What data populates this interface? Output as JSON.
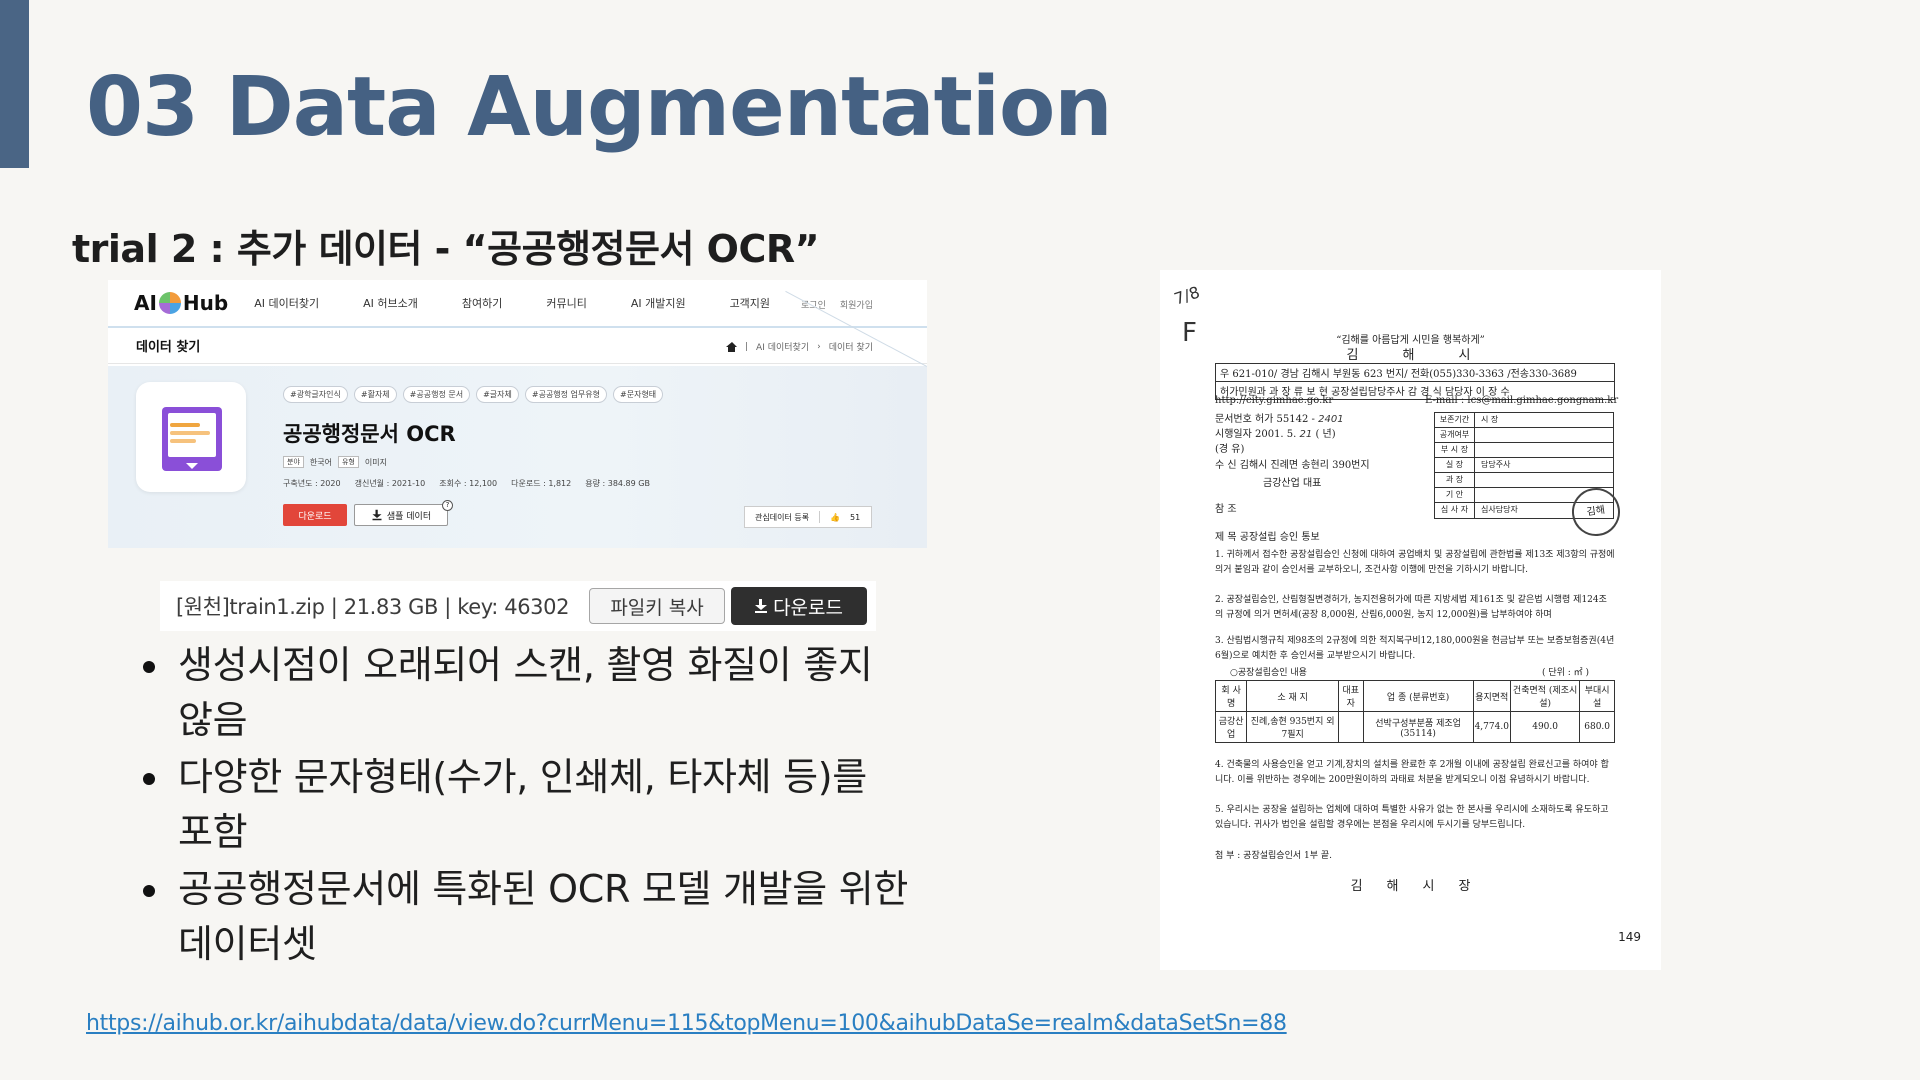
{
  "slide": {
    "title": "03 Data Augmentation",
    "subtitle": "trial 2 : 추가 데이터 - “공공행정문서 OCR”",
    "accent_color": "#4a6585"
  },
  "aihub": {
    "logo_left": "AI",
    "logo_right": "Hub",
    "nav": [
      "AI 데이터찾기",
      "AI 허브소개",
      "참여하기",
      "커뮤니티",
      "AI 개발지원",
      "고객지원"
    ],
    "login": "로그인",
    "signup": "회원가입",
    "section_title": "데이터 찾기",
    "breadcrumb": [
      "AI 데이터찾기",
      "데이터 찾기"
    ],
    "tags": [
      "#광학글자인식",
      "#활자체",
      "#공공행정 문서",
      "#글자체",
      "#공공행정 업무유형",
      "#문자형태"
    ],
    "dataset_title": "공공행정문서 OCR",
    "meta": {
      "field_label": "분야",
      "field_value": "한국어",
      "type_label": "유형",
      "type_value": "이미지",
      "build_year": "구축년도 : 2020",
      "updated": "갱신년월 : 2021-10",
      "views": "조회수 : 12,100",
      "downloads": "다운로드 : 1,812",
      "size": "용량 : 384.89 GB"
    },
    "download_btn": "다운로드",
    "sample_btn": "샘플 데이터",
    "help_mark": "?",
    "favorite_btn": "관심데이터 등록",
    "like_count": "51",
    "brand_color": "#e2463a"
  },
  "download_bar": {
    "file_info": "[원천]train1.zip | 21.83 GB | key: 46302",
    "copy_btn": "파일키 복사",
    "download_btn": "다운로드"
  },
  "bullets": [
    "생성시점이 오래되어 스캔, 촬영 화질이 좋지 않음",
    "다양한 문자형태(수가, 인쇄체, 타자체 등)를 포함",
    "공공행정문서에 특화된 OCR 모델 개발을 위한 데이터셋"
  ],
  "source_url": "https://aihub.or.kr/aihubdata/data/view.do?currMenu=115&topMenu=100&aihubDataSe=realm&dataSetSn=88",
  "scan": {
    "handwriting_1": "7/8",
    "handwriting_2": "F",
    "slogan": "“김해를 아름답게 시민을 행복하게”",
    "city": "김해시",
    "header_1": "우 621-010/ 경남 김해시 부원동 623 번지/ 전화(055)330-3363 /전송330-3689",
    "header_2": "허가민원과 과 장 류 보 현 공장설립담당주사 감 경 식 담당자 이 장 수",
    "homepage": "http://city.gimhae.go.kr",
    "email": "E-mail : lcs@mail.gimhae.gongnam.kr",
    "doc_no": "문서번호 허가 55142 -",
    "doc_no_hw": "2401",
    "date": "시행일자 2001. 5.",
    "date_hw": "21",
    "date_suffix": "( 년)",
    "reason": "(경 유)",
    "recipient": "수 신 김해시 진례면 송현리 390번지",
    "recipient_2": "금강산업 대표",
    "ref": "참 조",
    "subject": "제 목 공장설립 승인 통보",
    "approval": [
      {
        "k": "보존기간",
        "v": "시 장"
      },
      {
        "k": "공개여부",
        "v": ""
      },
      {
        "k": "부 시 장",
        "v": ""
      },
      {
        "k": "실 장",
        "v": "담당주사"
      },
      {
        "k": "과 장",
        "v": ""
      },
      {
        "k": "기 안",
        "v": ""
      },
      {
        "k": "심 사 자",
        "v": "심사담당자"
      }
    ],
    "stamp": "김해",
    "para_1": "1. 귀하께서 접수한 공장설립승인 신청에 대하여 공업배치 및 공장설립에 관한법률 제13조 제3항의 규정에 의거 붙임과 같이 승인서를 교부하오니, 조건사항 이행에 만전을 기하시기 바랍니다.",
    "para_2": "2. 공장설립승인, 산림형질변경허가, 농지전용허가에 따른 지방세법 제161조 및 같은법 시행령 제124조의 규정에 의거 면허세(공장 8,000원, 산림6,000원, 농지 12,000원)를 납부하여야 하며",
    "para_3": "3. 산림법시행규칙 제98조의 2규정에 의한 적지복구비12,180,000원을 현금납부 또는 보증보험증권(4년 6월)으로 예치한 후 승인서를 교부받으시기 바랍니다.",
    "table_caption": "○공장설립승인 내용",
    "table_unit": "( 단위 : ㎡ )",
    "table_headers": [
      "회 사 명",
      "소 재 지",
      "대표자",
      "업 종 (분류번호)",
      "용지면적",
      "건축면적 (제조시설)",
      "부대시설"
    ],
    "table_row": [
      "금강산업",
      "진례,송현 935번지 외7필지",
      "",
      "선박구성부분품 제조업 (35114)",
      "4,774.0",
      "490.0",
      "680.0"
    ],
    "para_4": "4. 건축물의 사용승인을 얻고 기계,장치의 설치를 완료한 후 2개월 이내에 공장설립 완료신고를 하여야 합니다. 이를 위반하는 경우에는 200만원이하의 과태료 처분을 받게되오니 이점 유념하시기 바랍니다.",
    "para_5": "5. 우리시는 공장을 설립하는 업체에 대하여 특별한 사유가 없는 한 본사를 우리시에 소재하도록 유도하고 있습니다. 귀사가 법인을 설립할 경우에는 본점을 우리시에 두시기를 당부드립니다.",
    "attachment": "첨 부 : 공장설립승인서 1부 끝.",
    "mayor": "김해시장",
    "page_no": "149"
  }
}
